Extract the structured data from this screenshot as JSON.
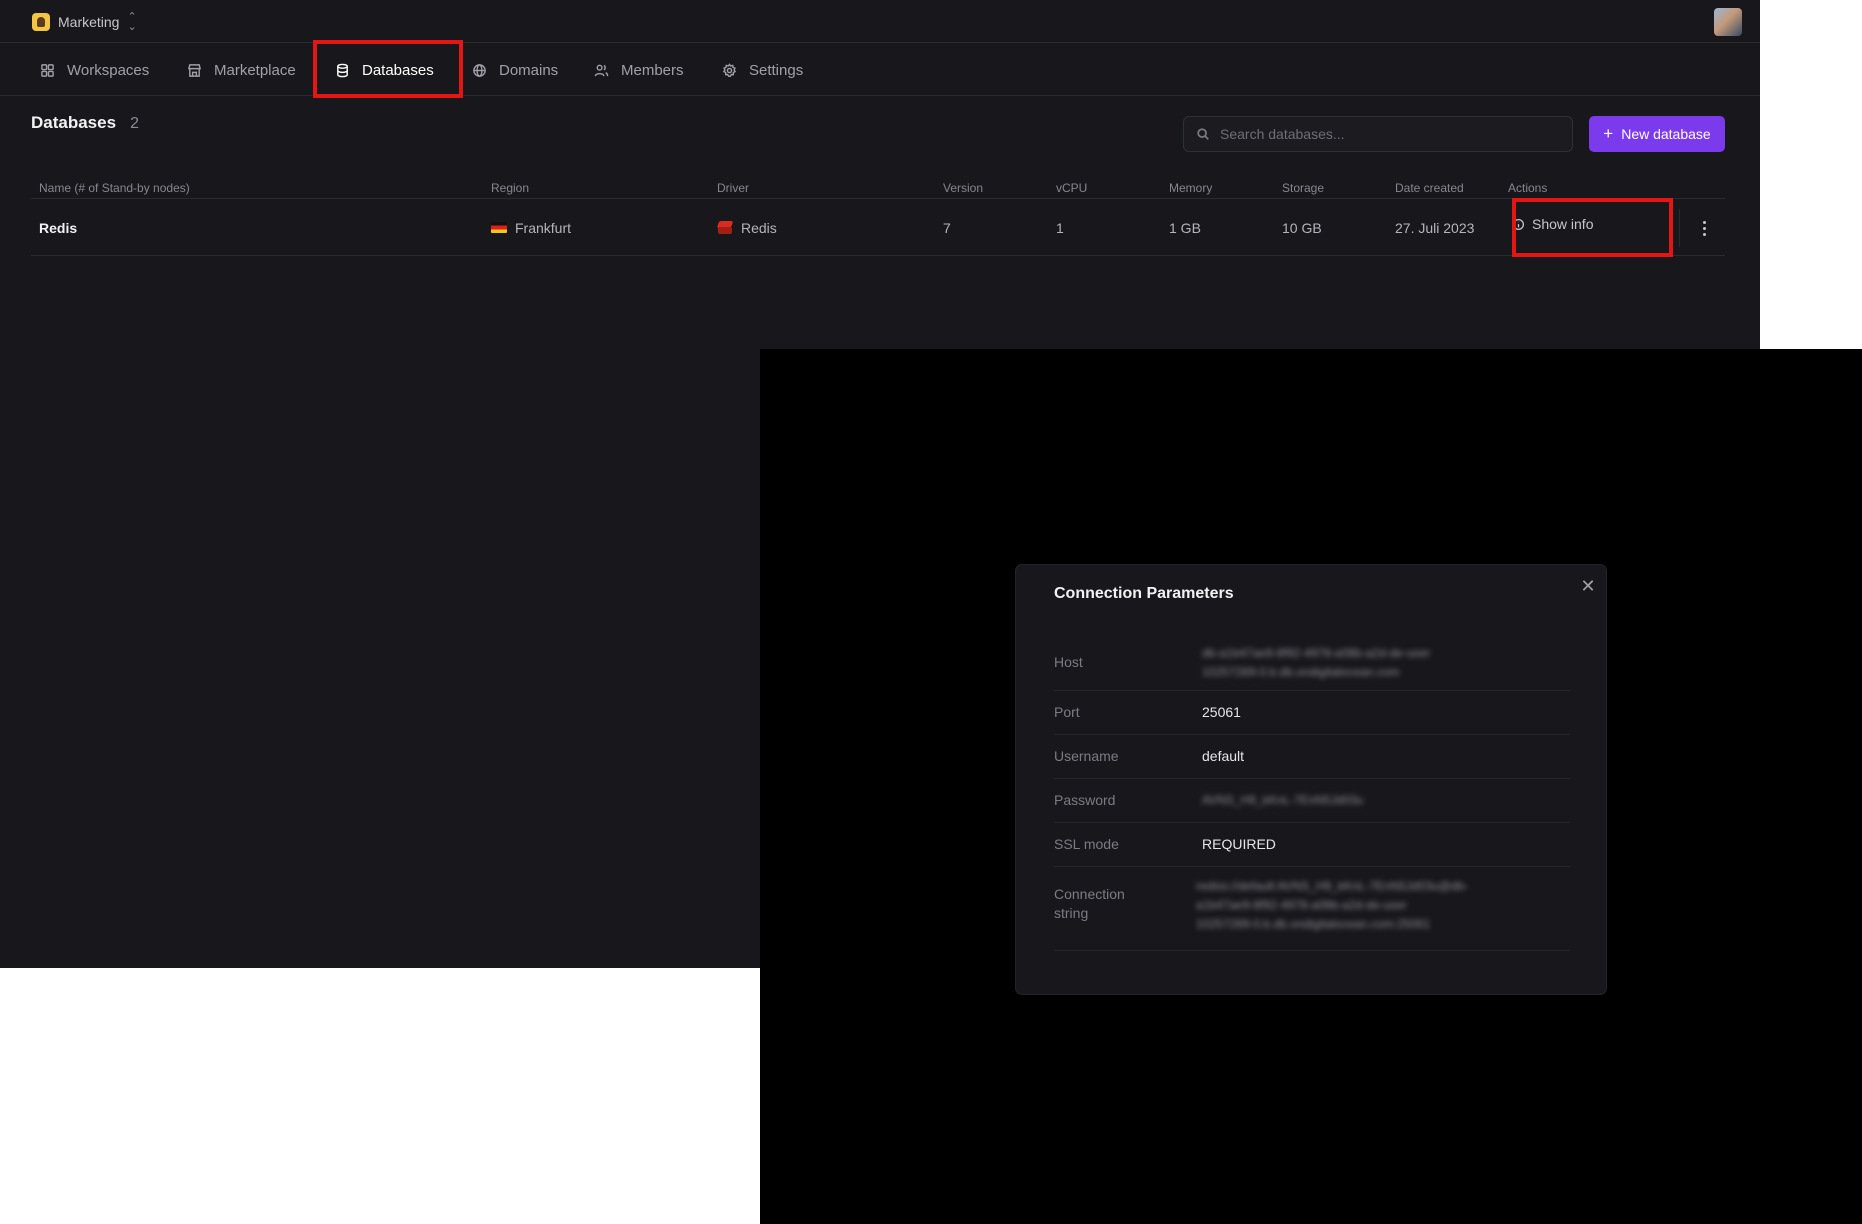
{
  "topbar": {
    "org_name": "Marketing",
    "org_switch_icon": "chevron-up-down-icon",
    "avatar": "user-avatar"
  },
  "nav": {
    "items": [
      {
        "label": "Workspaces",
        "icon": "grid-icon"
      },
      {
        "label": "Marketplace",
        "icon": "store-icon"
      },
      {
        "label": "Databases",
        "icon": "database-icon",
        "active": true
      },
      {
        "label": "Domains",
        "icon": "globe-icon"
      },
      {
        "label": "Members",
        "icon": "users-icon"
      },
      {
        "label": "Settings",
        "icon": "gear-icon"
      }
    ]
  },
  "page": {
    "title": "Databases",
    "count": "2"
  },
  "search": {
    "placeholder": "Search databases..."
  },
  "new_database_label": "New database",
  "table": {
    "columns": [
      "Name (# of Stand-by nodes)",
      "Region",
      "Driver",
      "Version",
      "vCPU",
      "Memory",
      "Storage",
      "Date created",
      "Actions"
    ],
    "rows": [
      {
        "name": "Redis",
        "region": "Frankfurt",
        "driver": "Redis",
        "version": "7",
        "vcpu": "1",
        "memory": "1 GB",
        "storage": "10 GB",
        "date_created": "27. Juli 2023",
        "action_label": "Show info"
      }
    ]
  },
  "modal": {
    "title": "Connection Parameters",
    "params": [
      {
        "label": "Host",
        "value_lines": [
          "db-a1b47ae9-8f92-4978-a08b-a2d-de-user",
          "10257289-0.b.db.ondigitalocean.com"
        ],
        "blurred": true
      },
      {
        "label": "Port",
        "value": "25061"
      },
      {
        "label": "Username",
        "value": "default"
      },
      {
        "label": "Password",
        "value": "AVNS_H9_kKnL-7EnN5Jd03u",
        "blurred": true
      },
      {
        "label": "SSL mode",
        "value": "REQUIRED"
      },
      {
        "label": "Connection string",
        "value_lines": [
          "rediss://default:AVNS_H9_kKnL-7EnN5Jd03u@db-",
          "a1b47ae9-8f92-4978-a08b-a2d-de-user",
          "10257289-0.b.db.ondigitalocean.com:25061"
        ],
        "blurred": true
      }
    ]
  },
  "colors": {
    "app_background": "#18181c",
    "accent": "#7c3aed",
    "highlight": "#e31515",
    "overlay": "#000000"
  }
}
